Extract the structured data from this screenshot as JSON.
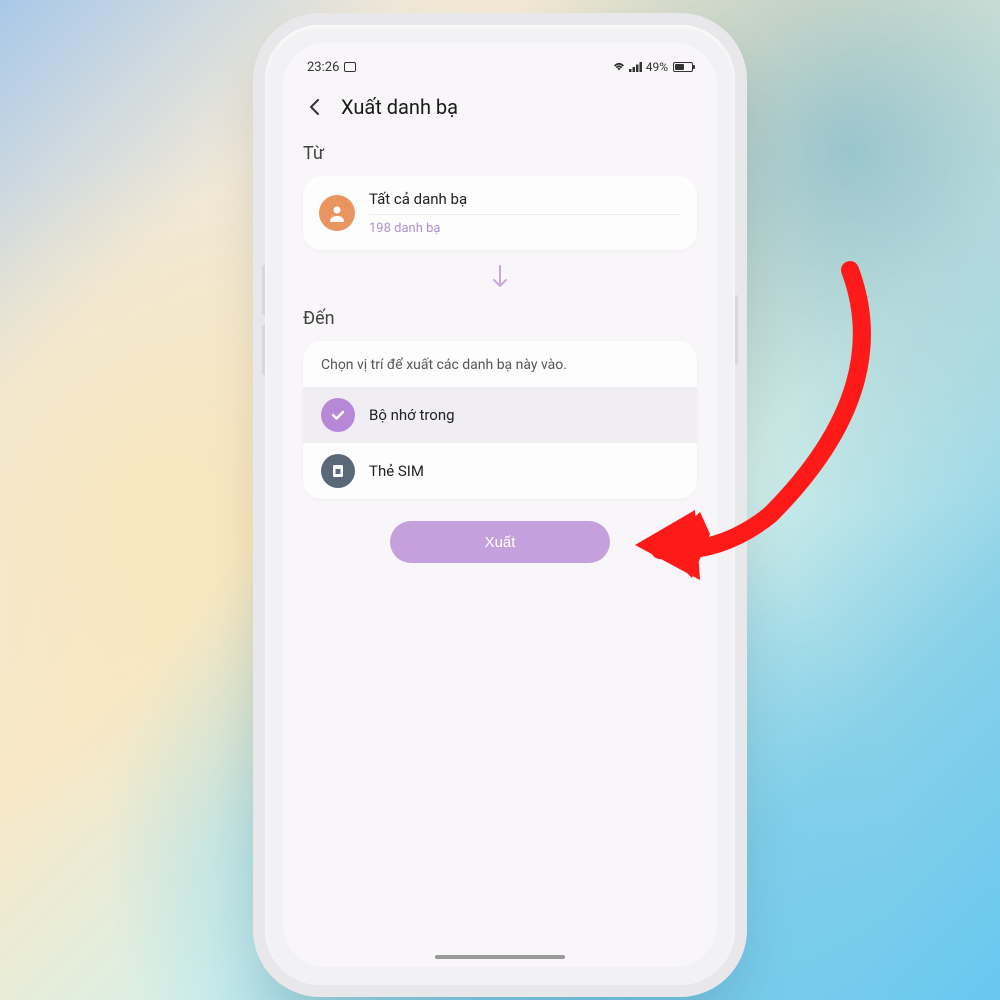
{
  "statusBar": {
    "time": "23:26",
    "battery": "49%"
  },
  "header": {
    "title": "Xuất danh bạ"
  },
  "from": {
    "label": "Từ",
    "source": "Tất cả danh bạ",
    "count": "198 danh bạ"
  },
  "to": {
    "label": "Đến",
    "hint": "Chọn vị trí để xuất các danh bạ này vào.",
    "options": [
      {
        "label": "Bộ nhớ trong",
        "selected": true
      },
      {
        "label": "Thẻ SIM",
        "selected": false
      }
    ]
  },
  "actions": {
    "export": "Xuất"
  }
}
